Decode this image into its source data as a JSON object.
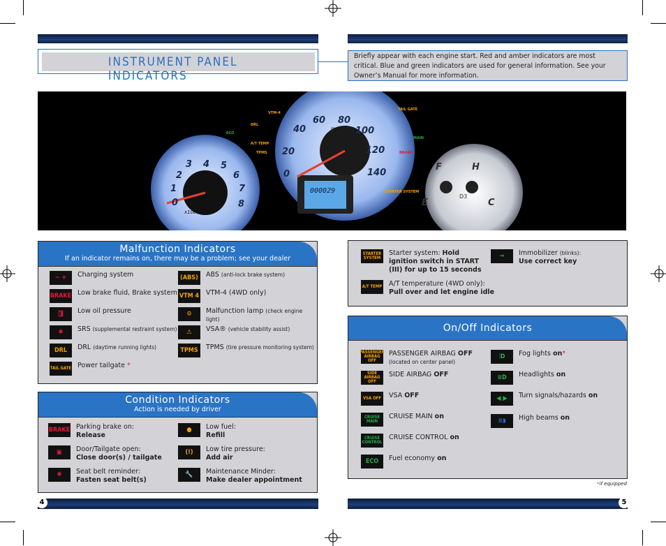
{
  "header": {
    "title": "INSTRUMENT PANEL INDICATORS",
    "description": "Briefly appear with each engine start. Red and amber indicators are most critical. Blue and green indicators are used for general information. See your Owner’s Manual for more information."
  },
  "dashboard": {
    "tach_numbers": [
      "0",
      "1",
      "2",
      "3",
      "4",
      "5",
      "6",
      "7",
      "8"
    ],
    "tach_unit": "x1000r/min",
    "speed_numbers": [
      "0",
      "20",
      "40",
      "60",
      "80",
      "100",
      "120",
      "140"
    ],
    "speed_unit": "mph",
    "odometer": "000029",
    "fuel_labels": [
      "F",
      "E"
    ],
    "temp_labels": [
      "H",
      "C"
    ],
    "gear": "D3",
    "labels": [
      "VTM-4",
      "DRL",
      "ECO",
      "A/T TEMP",
      "TPMS",
      "BRAKE",
      "STARTER SYSTEM",
      "MAIN",
      "TAIL GATE"
    ]
  },
  "malfunction": {
    "title": "Malfunction Indicators",
    "subtitle": "If an indicator remains on, there may be a problem; see your dealer",
    "items": [
      {
        "icon": "battery-icon",
        "label": "Charging system",
        "note": "",
        "color": "#e8173a"
      },
      {
        "icon": "ABS",
        "label": "ABS",
        "note": "(anti-lock brake system)",
        "color": "#f5a300"
      },
      {
        "icon": "BRAKE",
        "label": "Low brake fluid, Brake system",
        "note": "",
        "color": "#e8173a"
      },
      {
        "icon": "VTM 4",
        "label": "VTM-4 (4WD only)",
        "note": "",
        "color": "#f5a300"
      },
      {
        "icon": "oil-can-icon",
        "label": "Low oil pressure",
        "note": "",
        "color": "#e8173a"
      },
      {
        "icon": "engine-icon",
        "label": "Malfunction lamp",
        "note": "(check engine light)",
        "color": "#f5a300"
      },
      {
        "icon": "airbag-icon",
        "label": "SRS",
        "note": "(supplemental restraint system)",
        "color": "#e8173a"
      },
      {
        "icon": "skid-car-icon",
        "label": "VSA®",
        "note": "(vehicle stability assist)",
        "color": "#f5a300"
      },
      {
        "icon": "DRL",
        "label": "DRL",
        "note": "(daytime running lights)",
        "color": "#f5a300"
      },
      {
        "icon": "TPMS",
        "label": "TPMS",
        "note": "(tire pressure monitoring system)",
        "color": "#f5a300"
      },
      {
        "icon": "TAIL GATE",
        "label": "Power tailgate",
        "note": "*",
        "color": "#f5a300"
      }
    ]
  },
  "condition": {
    "title": "Condition Indicators",
    "subtitle": "Action is needed by driver",
    "items": [
      {
        "icon": "BRAKE",
        "label": "Parking brake on:",
        "action": "Release",
        "color": "#e8173a"
      },
      {
        "icon": "fuel-dot-icon",
        "label": "Low fuel:",
        "action": "Refill",
        "color": "#f5a300"
      },
      {
        "icon": "door-open-icon",
        "label": "Door/Tailgate open:",
        "action": "Close door(s) / tailgate",
        "color": "#e8173a"
      },
      {
        "icon": "tire-pressure-icon",
        "label": "Low tire pressure:",
        "action": "Add air",
        "color": "#f5a300"
      },
      {
        "icon": "seatbelt-icon",
        "label": "Seat belt reminder:",
        "action": "Fasten seat belt(s)",
        "color": "#e8173a"
      },
      {
        "icon": "wrench-icon",
        "label": "Maintenance Minder:",
        "action": "Make dealer appointment",
        "color": "#f5a300"
      }
    ]
  },
  "other": {
    "items": [
      {
        "icon": "STARTER SYSTEM",
        "label": "Starter system: ",
        "action": "Hold ignition switch in START (III) for up to 15 seconds",
        "color": "#f5a300"
      },
      {
        "icon": "key-icon",
        "label": "Immobilizer ",
        "note": "(blinks):",
        "action": "Use correct key",
        "color": "#22b14c"
      },
      {
        "icon": "A/T TEMP",
        "label": "A/T temperature (4WD only):",
        "action": "Pull over and let engine idle",
        "color": "#f5a300"
      }
    ]
  },
  "onoff": {
    "title": "On/Off Indicators",
    "items": [
      {
        "icon": "PASSENGER AIRBAG OFF",
        "label": "PASSENGER AIRBAG ",
        "bold": "OFF",
        "note": "(located on center panel)",
        "color": "#f5a300"
      },
      {
        "icon": "fog-light-icon",
        "label": "Fog lights ",
        "bold": "on",
        "star": "*",
        "color": "#22b14c"
      },
      {
        "icon": "SIDE AIRBAG OFF",
        "label": "SIDE AIRBAG ",
        "bold": "OFF",
        "color": "#f5a300"
      },
      {
        "icon": "headlight-icon",
        "label": "Headlights ",
        "bold": "on",
        "color": "#22b14c"
      },
      {
        "icon": "VSA OFF",
        "label": "VSA ",
        "bold": "OFF",
        "color": "#f5a300"
      },
      {
        "icon": "turn-signal-icon",
        "label": "Turn signals/hazards ",
        "bold": "on",
        "color": "#22b14c"
      },
      {
        "icon": "CRUISE MAIN",
        "label": "CRUISE MAIN ",
        "bold": "on",
        "color": "#22b14c"
      },
      {
        "icon": "high-beam-icon",
        "label": "High beams ",
        "bold": "on",
        "color": "#2a70d0"
      },
      {
        "icon": "CRUISE CONTROL",
        "label": "CRUISE CONTROL ",
        "bold": "on",
        "color": "#22b14c"
      },
      {
        "icon": "ECO",
        "label": "Fuel economy ",
        "bold": "on",
        "color": "#22b14c"
      }
    ],
    "footnote_star": "*",
    "footnote": "if equipped"
  },
  "pages": {
    "left": "4",
    "right": "5"
  }
}
